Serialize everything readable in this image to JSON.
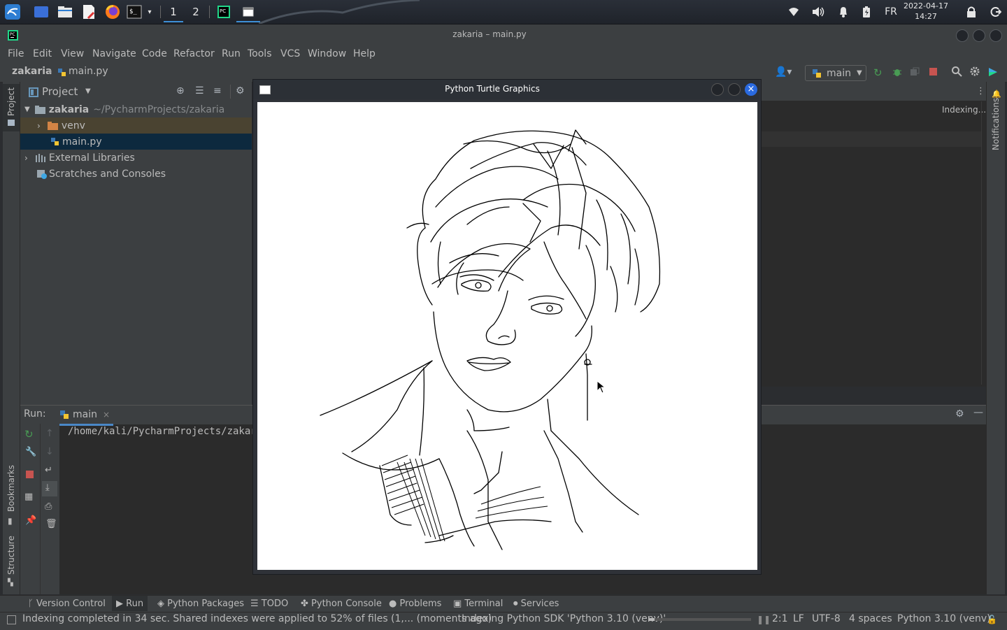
{
  "taskbar": {
    "workspaces": [
      "1",
      "2"
    ],
    "keyboard_layout": "FR",
    "date": "2022-04-17",
    "time": "14:27"
  },
  "window": {
    "title": "zakaria – main.py"
  },
  "menu": [
    "File",
    "Edit",
    "View",
    "Navigate",
    "Code",
    "Refactor",
    "Run",
    "Tools",
    "VCS",
    "Window",
    "Help"
  ],
  "navbar": {
    "project": "zakaria",
    "file": "main.py",
    "run_config": "main"
  },
  "project_panel": {
    "title": "Project",
    "root_name": "zakaria",
    "root_path": "~/PycharmProjects/zakaria",
    "items": [
      "venv",
      "main.py",
      "External Libraries",
      "Scratches and Consoles"
    ]
  },
  "side_labels": {
    "project": "Project",
    "bookmarks": "Bookmarks",
    "structure": "Structure",
    "notifications": "Notifications"
  },
  "editor": {
    "status": "Indexing..."
  },
  "run": {
    "label": "Run:",
    "tab": "main",
    "output": "/home/kali/PycharmProjects/zakari"
  },
  "turtle_window": {
    "title": "Python Turtle Graphics"
  },
  "bottom_tabs": [
    "Version Control",
    "Run",
    "Python Packages",
    "TODO",
    "Python Console",
    "Problems",
    "Terminal",
    "Services"
  ],
  "status": {
    "message": "Indexing completed in 34 sec. Shared indexes were applied to 52% of files (1,... (moments ago)",
    "task": "Indexing Python SDK 'Python 3.10 (venv)'",
    "position": "2:1",
    "line_sep": "LF",
    "encoding": "UTF-8",
    "indent": "4 spaces",
    "interpreter": "Python 3.10 (venv)"
  },
  "colors": {
    "accent": "#3d8fd6",
    "selection": "#0d293e",
    "folder": "#d28445",
    "stop": "#c75450",
    "run_green": "#499c54"
  }
}
